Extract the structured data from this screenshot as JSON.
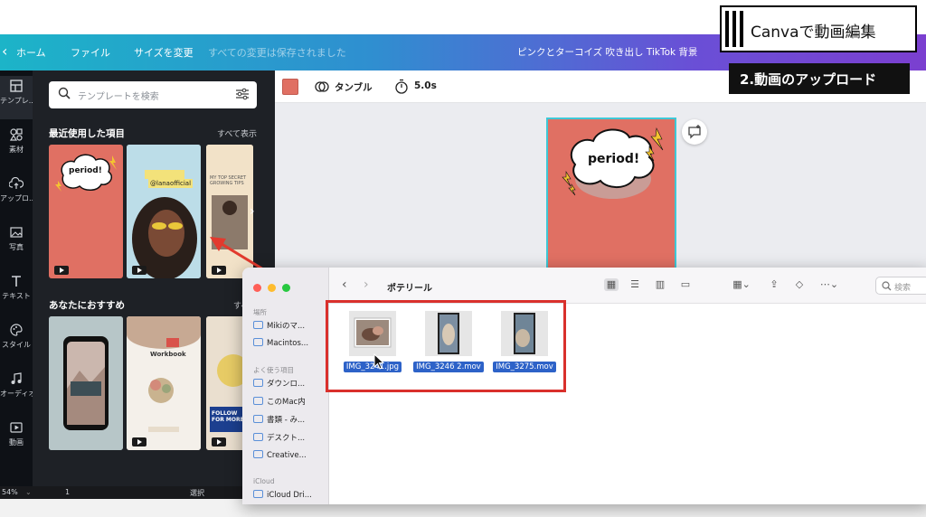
{
  "topbar": {
    "home": "ホーム",
    "file": "ファイル",
    "resize": "サイズを変更",
    "saved_status": "すべての変更は保存されました",
    "doc_title": "ピンクとターコイズ 吹き出し TikTok 背景"
  },
  "rail": {
    "items": [
      {
        "label": "テンプレ..."
      },
      {
        "label": "素材"
      },
      {
        "label": "アップロ..."
      },
      {
        "label": "写真"
      },
      {
        "label": "テキスト"
      },
      {
        "label": "スタイル"
      },
      {
        "label": "オーディオ"
      },
      {
        "label": "動画"
      }
    ]
  },
  "panel": {
    "search_placeholder": "テンプレートを検索",
    "recent_title": "最近使用した項目",
    "recent_link": "すべて表示",
    "recommended_title": "あなたにおすすめ",
    "recommended_link": "すべて",
    "thumb_texts": {
      "period": "period!",
      "handle": "@lanaofficial",
      "secret": "MY TOP SECRET GROWING TIPS",
      "workbook": "Workbook",
      "follow": "FOLLOW FOR MORE"
    }
  },
  "toolbar": {
    "swatch_color": "#e07063",
    "tumble": "タンブル",
    "duration": "5.0s"
  },
  "canvas": {
    "bubble_text": "period!"
  },
  "banner": {
    "title": "Canvaで動画編集",
    "subtitle": "2.動画のアップロード"
  },
  "bottombar": {
    "zoom": "54%",
    "page": "1",
    "select": "選択"
  },
  "finder": {
    "sidebar": {
      "group_locations": "場所",
      "locations": [
        "Mikiのマ...",
        "Macintos..."
      ],
      "group_favorites": "よく使う項目",
      "favorites": [
        "ダウンロ...",
        "このMac内",
        "書類 - み...",
        "デスクト...",
        "Creative..."
      ],
      "group_icloud": "iCloud",
      "icloud": [
        "iCloud Dri..."
      ]
    },
    "location": "ポテリール",
    "search_placeholder": "検索",
    "files": [
      {
        "name": "IMG_3241.jpg"
      },
      {
        "name": "IMG_3246 2.mov"
      },
      {
        "name": "IMG_3275.mov"
      }
    ]
  },
  "colors": {
    "accent": "#d9302c",
    "selection": "#2d62c8",
    "canvas_page": "#e07063",
    "page_border": "#3fc8d6"
  }
}
